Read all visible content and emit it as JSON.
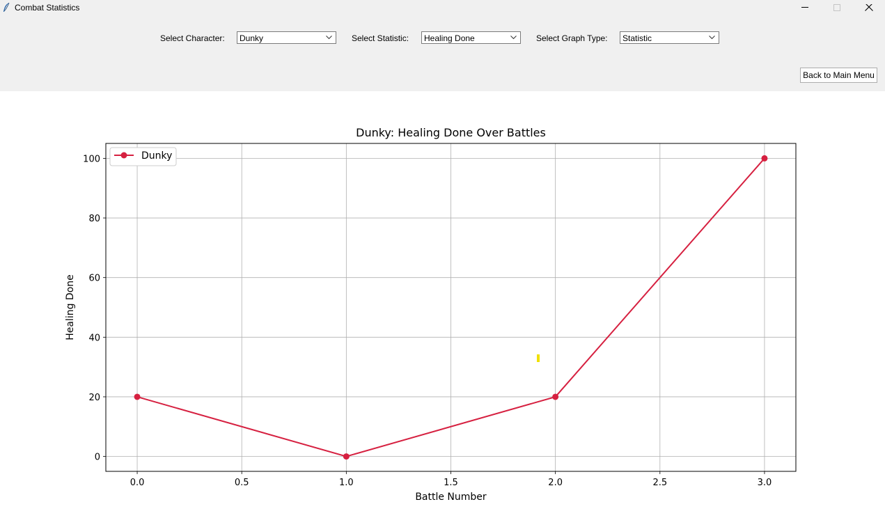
{
  "window": {
    "title": "Combat Statistics"
  },
  "toolbar": {
    "character_label": "Select Character:",
    "character_value": "Dunky",
    "statistic_label": "Select Statistic:",
    "statistic_value": "Healing Done",
    "graph_type_label": "Select Graph Type:",
    "graph_type_value": "Statistic",
    "back_label": "Back to Main Menu"
  },
  "colors": {
    "series": "#d62040",
    "marker_yellow": "#f0e000",
    "chrome": "#f0f0f0"
  },
  "chart_data": {
    "type": "line",
    "title": "Dunky: Healing Done Over Battles",
    "xlabel": "Battle Number",
    "ylabel": "Healing Done",
    "xlim": [
      -0.15,
      3.15
    ],
    "ylim": [
      -5,
      105
    ],
    "xticks": [
      0.0,
      0.5,
      1.0,
      1.5,
      2.0,
      2.5,
      3.0
    ],
    "xtick_labels": [
      "0.0",
      "0.5",
      "1.0",
      "1.5",
      "2.0",
      "2.5",
      "3.0"
    ],
    "yticks": [
      0,
      20,
      40,
      60,
      80,
      100
    ],
    "ytick_labels": [
      "0",
      "20",
      "40",
      "60",
      "80",
      "100"
    ],
    "grid": true,
    "legend": "upper-left",
    "series": [
      {
        "name": "Dunky",
        "x": [
          0,
          1,
          2,
          3
        ],
        "y": [
          20,
          0,
          20,
          100
        ]
      }
    ]
  }
}
